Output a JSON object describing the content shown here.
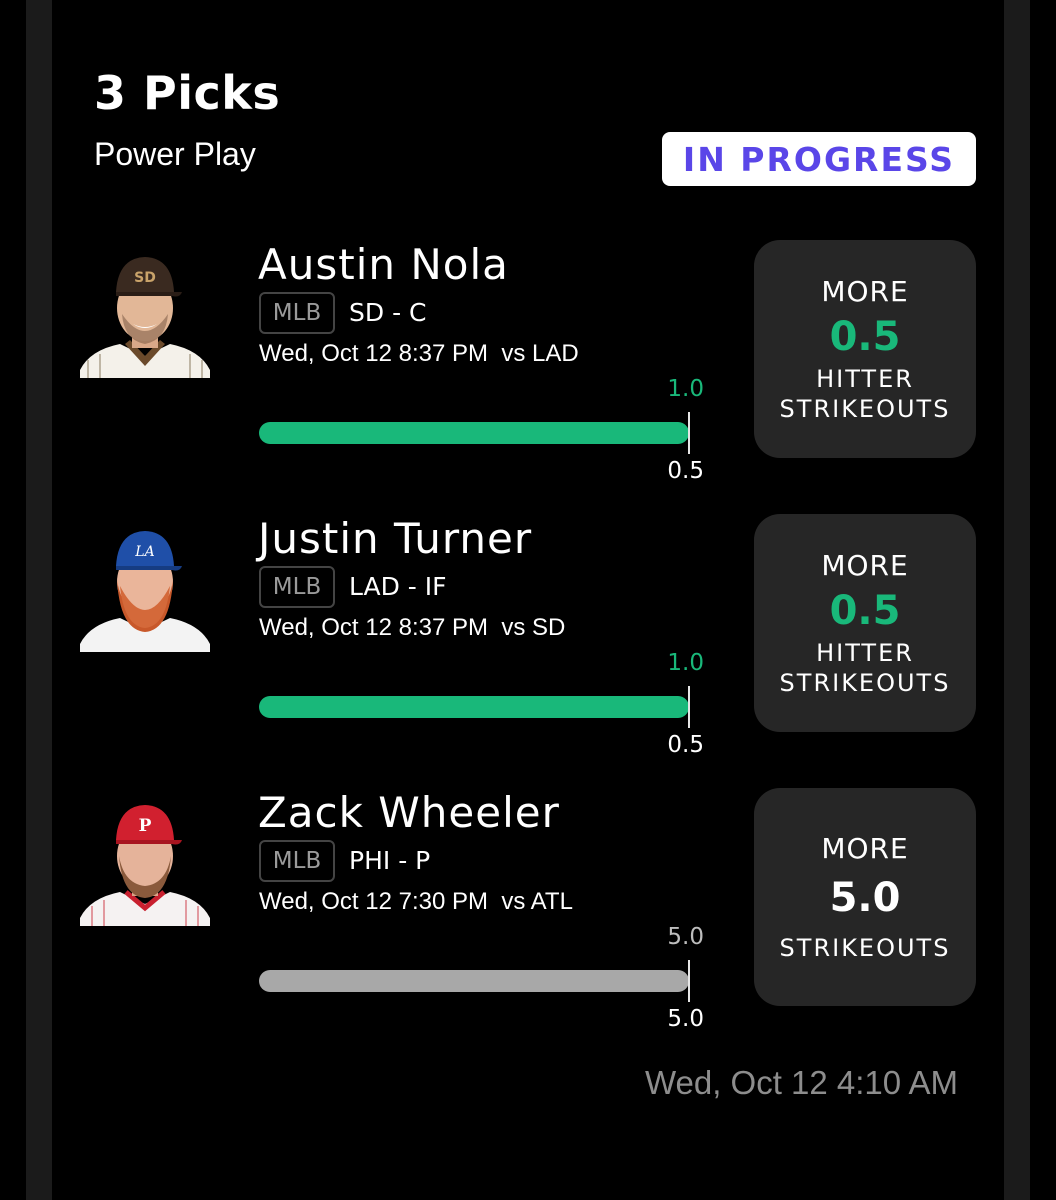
{
  "header": {
    "title": "3 Picks",
    "subtitle": "Power Play",
    "status": "IN PROGRESS"
  },
  "colors": {
    "accent_green": "#19b87a",
    "badge_text": "#5a46e8",
    "line_box": "#262626",
    "neutral_bar": "#a8a8a8"
  },
  "picks": [
    {
      "name": "Austin Nola",
      "league": "MLB",
      "team_pos": "SD - C",
      "game": "Wed, Oct 12 8:37 PM  vs LAD",
      "progress_top": "1.0",
      "progress_bottom": "0.5",
      "line_dir": "MORE",
      "line_val": "0.5",
      "stat_1": "HITTER",
      "stat_2": "STRIKEOUTS",
      "avatar_icon": "player-headshot-padres-cap"
    },
    {
      "name": "Justin Turner",
      "league": "MLB",
      "team_pos": "LAD - IF",
      "game": "Wed, Oct 12 8:37 PM  vs SD",
      "progress_top": "1.0",
      "progress_bottom": "0.5",
      "line_dir": "MORE",
      "line_val": "0.5",
      "stat_1": "HITTER",
      "stat_2": "STRIKEOUTS",
      "avatar_icon": "player-headshot-dodgers-cap"
    },
    {
      "name": "Zack Wheeler",
      "league": "MLB",
      "team_pos": "PHI - P",
      "game": "Wed, Oct 12 7:30 PM  vs ATL",
      "progress_top": "5.0",
      "progress_bottom": "5.0",
      "line_dir": "MORE",
      "line_val": "5.0",
      "stat_1": "",
      "stat_2": "STRIKEOUTS",
      "avatar_icon": "player-headshot-phillies-cap"
    }
  ],
  "footer": {
    "timestamp": "Wed, Oct 12 4:10 AM"
  }
}
